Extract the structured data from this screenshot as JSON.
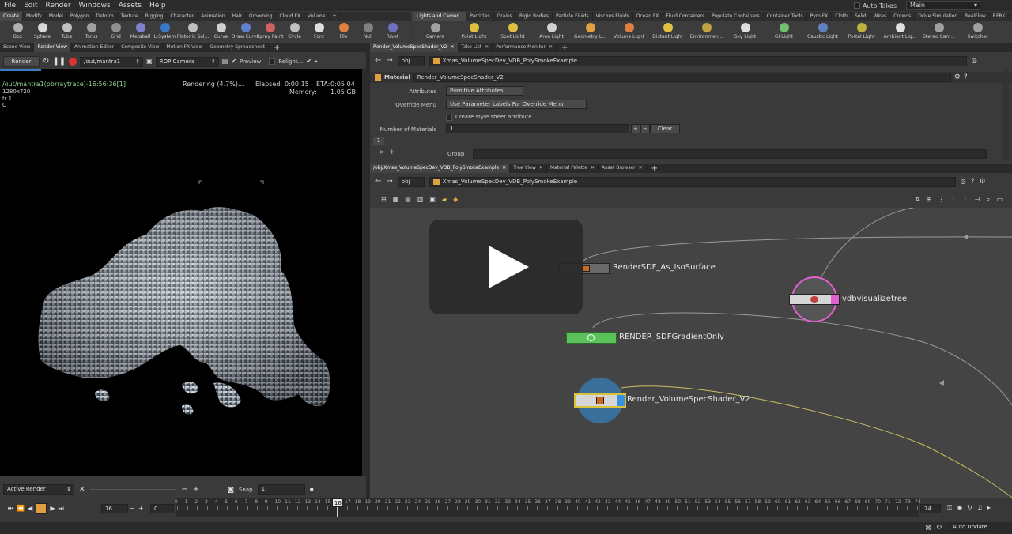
{
  "menu": [
    "File",
    "Edit",
    "Render",
    "Windows",
    "Assets",
    "Help"
  ],
  "header_right": {
    "auto_takes": "Auto Takes",
    "desktop": "Main"
  },
  "shelf_left_tabs": [
    "Create",
    "Modify",
    "Model",
    "Polygon",
    "Deform",
    "Texture",
    "Rigging",
    "Character",
    "Animation",
    "Hair",
    "Grooming",
    "Cloud FX",
    "Volume"
  ],
  "shelf_left_tools": [
    "Box",
    "Sphere",
    "Tube",
    "Torus",
    "Grid",
    "Metaball",
    "L-System",
    "Platonic Sol...",
    "Curve",
    "Draw Curve",
    "Spray Paint",
    "Circle",
    "Font",
    "File",
    "Null",
    "Rivet"
  ],
  "shelf_right_tabs": [
    "Lights and Camer...",
    "Particles",
    "Grains",
    "Rigid Bodies",
    "Particle Fluids",
    "Viscous Fluids",
    "Ocean FX",
    "Fluid Containers",
    "Populate Containers",
    "Container Tools",
    "Pyro FX",
    "Cloth",
    "Solid",
    "Wires",
    "Crowds",
    "Drive Simulation",
    "RealFlow",
    "RFRK"
  ],
  "shelf_right_tools": [
    "Camera",
    "Point Light",
    "Spot Light",
    "Area Light",
    "Geometry L...",
    "Volume Light",
    "Distant Light",
    "Environmen...",
    "Sky Light",
    "GI Light",
    "Caustic Light",
    "Portal Light",
    "Ambient Lig...",
    "Stereo Cam...",
    "Switcher"
  ],
  "left_pane_tabs": [
    "Scene View",
    "Render View",
    "Animation Editor",
    "Composite View",
    "Motion FX View",
    "Geometry Spreadsheet"
  ],
  "render_toolbar": {
    "render": "Render",
    "rop_path": "/out/mantra1",
    "camera": "ROP Camera",
    "preview": "Preview",
    "relight": "Relight..."
  },
  "render_info": {
    "title": "/out/mantra1(pbrraytrace)-16:56:36[1]",
    "res": "1280x720",
    "frame": "fr 1",
    "channel": "C",
    "status": "Rendering (4.7%)...",
    "elapsed_label": "Elapsed:",
    "elapsed": "0:00:15",
    "eta_label": "ETA:",
    "eta": "0:05:04",
    "memory_label": "Memory:",
    "memory": "1.05 GB"
  },
  "render_progress": 0.047,
  "bottom_left": {
    "active_render": "Active Render",
    "snap": "Snap",
    "snap_value": "1"
  },
  "param_tabs": [
    "Render_VolumeSpecShader_V2",
    "Take List",
    "Performance Monitor"
  ],
  "param_path": "Xmas_VolumeSpecDev_VDB_PolySmokeExample",
  "param_context": "obj",
  "material": {
    "type": "Material",
    "name": "Render_VolumeSpecShader_V2"
  },
  "params": {
    "attributes_label": "Attributes",
    "attributes_value": "Primitive Attributes",
    "override_label": "Override Menu",
    "override_value": "Use Parameter Labels For Override Menu",
    "style_sheet": "Create style sheet attribute",
    "num_materials_label": "Number of Materials",
    "num_materials": "1",
    "clear": "Clear",
    "tab_index": "1",
    "group_label": "Group"
  },
  "network_tabs": [
    "/obj/Xmas_VolumeSpecDev_VDB_PolySmokeExample",
    "Tree View",
    "Material Palette",
    "Asset Browser"
  ],
  "network_path": "Xmas_VolumeSpecDev_VDB_PolySmokeExample",
  "network_context": "obj",
  "nodes": {
    "n1": "RenderSDF_As_IsoSurface",
    "n2": "vdbvisualizetree",
    "n3": "RENDER_SDFGradientOnly",
    "n4": "Render_VolumeSpecShader_V2"
  },
  "playbar": {
    "current_frame": "16",
    "start": "0",
    "end": "74",
    "ticks": [
      "0",
      "1",
      "2",
      "3",
      "4",
      "5",
      "6",
      "7",
      "8",
      "9",
      "10",
      "11",
      "12",
      "13",
      "14",
      "15",
      "16",
      "17",
      "18",
      "19",
      "20",
      "21",
      "22",
      "23",
      "24",
      "25",
      "26",
      "27",
      "28",
      "29",
      "30",
      "31",
      "32",
      "33",
      "34",
      "35",
      "36",
      "37",
      "38",
      "39",
      "40",
      "41",
      "42",
      "43",
      "44",
      "45",
      "46",
      "47",
      "48",
      "49",
      "50",
      "51",
      "52",
      "53",
      "54",
      "55",
      "56",
      "57",
      "58",
      "59",
      "60",
      "61",
      "62",
      "63",
      "64",
      "65",
      "66",
      "67",
      "68",
      "69",
      "70",
      "71",
      "72",
      "73",
      "74"
    ]
  },
  "status": {
    "auto_update": "Auto Update"
  },
  "colors": {
    "accent_yellow": "#d8c23a",
    "node_green": "#5bc25b",
    "node_pink": "#e060d0",
    "node_blue": "#3a90e0",
    "play_orange": "#e0a040"
  }
}
